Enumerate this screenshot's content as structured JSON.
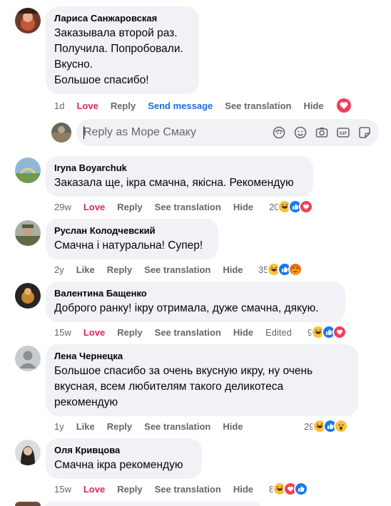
{
  "comments": [
    {
      "author": "Лариса Санжаровская",
      "lines": [
        "Заказывала второй раз.",
        "Получила. Попробовали.",
        "Вкусно.",
        "Большое спасибо!"
      ],
      "time": "1d",
      "love": "Love",
      "reply": "Reply",
      "send_message": "Send message",
      "see_translation": "See translation",
      "hide": "Hide"
    },
    {
      "author": "Iryna Boyarchuk",
      "lines": [
        "Заказала ще, ікра смачна, якісна. Рекомендую"
      ],
      "time": "29w",
      "love": "Love",
      "reply": "Reply",
      "see_translation": "See translation",
      "hide": "Hide",
      "reaction_count": "20",
      "reactions": [
        "haha",
        "like",
        "love"
      ]
    },
    {
      "author": "Руслан Колодчевский",
      "lines": [
        "Смачна і натуральна! Супер!"
      ],
      "time": "2y",
      "like": "Like",
      "reply": "Reply",
      "see_translation": "See translation",
      "hide": "Hide",
      "reaction_count": "35",
      "reactions": [
        "haha",
        "like",
        "angry"
      ]
    },
    {
      "author": "Валентина Бащенко",
      "lines": [
        "Доброго ранку! ікру отримала, дуже смачна, дякую."
      ],
      "time": "15w",
      "love": "Love",
      "reply": "Reply",
      "see_translation": "See translation",
      "hide": "Hide",
      "edited": "Edited",
      "reaction_count": "9",
      "reactions": [
        "haha",
        "like",
        "love"
      ]
    },
    {
      "author": "Лена Чернецка",
      "lines": [
        "Большое спасибо за очень вкусную икру, ну очень",
        "вкусная, всем любителям такого деликотеса",
        "рекомендую"
      ],
      "time": "1y",
      "like": "Like",
      "reply": "Reply",
      "see_translation": "See translation",
      "hide": "Hide",
      "reaction_count": "29",
      "reactions": [
        "haha",
        "like",
        "wow"
      ]
    },
    {
      "author": "Оля Кривцова",
      "lines": [
        "Смачна ікра рекомендую"
      ],
      "time": "15w",
      "love": "Love",
      "reply": "Reply",
      "see_translation": "See translation",
      "hide": "Hide",
      "reaction_count": "8",
      "reactions": [
        "haha",
        "love",
        "like"
      ]
    }
  ],
  "reply_box": {
    "placeholder": "Reply as Море Смаку",
    "icons": [
      "sticker-avatar-icon",
      "emoji-icon",
      "camera-icon",
      "gif-icon",
      "sticker-icon"
    ]
  },
  "colors": {
    "love": "#e0245e",
    "link_blue": "#1a6ed8",
    "secondary_text": "#65676b",
    "bubble": "#f0f2f5"
  }
}
